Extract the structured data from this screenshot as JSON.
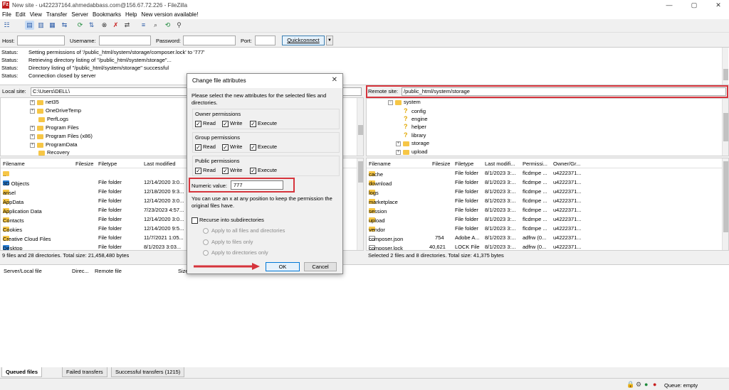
{
  "window": {
    "title": "New site - u422237164.ahmedabbass.com@156.67.72.226 - FileZilla",
    "app_icon": "Fz"
  },
  "menu": [
    "File",
    "Edit",
    "View",
    "Transfer",
    "Server",
    "Bookmarks",
    "Help",
    "New version available!"
  ],
  "quickconnect": {
    "host_label": "Host:",
    "username_label": "Username:",
    "password_label": "Password:",
    "port_label": "Port:",
    "button": "Quickconnect"
  },
  "log": [
    {
      "k": "Status:",
      "v": "Setting permissions of '/public_html/system/storage/composer.lock' to '777'"
    },
    {
      "k": "Status:",
      "v": "Retrieving directory listing of \"/public_html/system/storage\"..."
    },
    {
      "k": "Status:",
      "v": "Directory listing of \"/public_html/system/storage\" successful"
    },
    {
      "k": "Status:",
      "v": "Connection closed by server"
    }
  ],
  "local": {
    "site_label": "Local site:",
    "path": "C:\\Users\\DELL\\",
    "tree": [
      "net35",
      "OneDriveTemp",
      "PerfLogs",
      "Program Files",
      "Program Files (x86)",
      "ProgramData",
      "Recovery"
    ],
    "headers": {
      "name": "Filename",
      "size": "Filesize",
      "type": "Filetype",
      "modified": "Last modified"
    },
    "files": [
      {
        "name": "..",
        "size": "",
        "type": "",
        "modified": ""
      },
      {
        "name": "3D Objects",
        "size": "",
        "type": "File folder",
        "modified": "12/14/2020 3:0..."
      },
      {
        "name": "ansel",
        "size": "",
        "type": "File folder",
        "modified": "12/18/2020 9:3..."
      },
      {
        "name": "AppData",
        "size": "",
        "type": "File folder",
        "modified": "12/14/2020 3:0..."
      },
      {
        "name": "Application Data",
        "size": "",
        "type": "File folder",
        "modified": "7/23/2023 4:57..."
      },
      {
        "name": "Contacts",
        "size": "",
        "type": "File folder",
        "modified": "12/14/2020 3:0..."
      },
      {
        "name": "Cookies",
        "size": "",
        "type": "File folder",
        "modified": "12/14/2020 9:5..."
      },
      {
        "name": "Creative Cloud Files",
        "size": "",
        "type": "File folder",
        "modified": "11/7/2021 1:05..."
      },
      {
        "name": "Desktop",
        "size": "",
        "type": "File folder",
        "modified": "8/1/2023 3:03..."
      }
    ],
    "status": "9 files and 28 directories. Total size: 21,458,480 bytes"
  },
  "remote": {
    "site_label": "Remote site:",
    "path": "/public_html/system/storage",
    "tree": [
      {
        "name": "system",
        "kind": "folder"
      },
      {
        "name": "config",
        "kind": "unknown"
      },
      {
        "name": "engine",
        "kind": "unknown"
      },
      {
        "name": "helper",
        "kind": "unknown"
      },
      {
        "name": "library",
        "kind": "unknown"
      },
      {
        "name": "storage",
        "kind": "folder"
      },
      {
        "name": "upload",
        "kind": "folder"
      }
    ],
    "headers": {
      "name": "Filename",
      "size": "Filesize",
      "type": "Filetype",
      "modified": "Last modifi...",
      "perm": "Permissi...",
      "owner": "Owner/Gr..."
    },
    "files": [
      {
        "name": "cache",
        "size": "",
        "type": "File folder",
        "modified": "8/1/2023 3:...",
        "perm": "flcdmpe ...",
        "owner": "u4222371..."
      },
      {
        "name": "download",
        "size": "",
        "type": "File folder",
        "modified": "8/1/2023 3:...",
        "perm": "flcdmpe ...",
        "owner": "u4222371..."
      },
      {
        "name": "logs",
        "size": "",
        "type": "File folder",
        "modified": "8/1/2023 3:...",
        "perm": "flcdmpe ...",
        "owner": "u4222371..."
      },
      {
        "name": "marketplace",
        "size": "",
        "type": "File folder",
        "modified": "8/1/2023 3:...",
        "perm": "flcdmpe ...",
        "owner": "u4222371..."
      },
      {
        "name": "session",
        "size": "",
        "type": "File folder",
        "modified": "8/1/2023 3:...",
        "perm": "flcdmpe ...",
        "owner": "u4222371..."
      },
      {
        "name": "upload",
        "size": "",
        "type": "File folder",
        "modified": "8/1/2023 3:...",
        "perm": "flcdmpe ...",
        "owner": "u4222371..."
      },
      {
        "name": "vendor",
        "size": "",
        "type": "File folder",
        "modified": "8/1/2023 3:...",
        "perm": "flcdmpe ...",
        "owner": "u4222371..."
      },
      {
        "name": "composer.json",
        "size": "754",
        "type": "Adobe A...",
        "modified": "8/1/2023 3:...",
        "perm": "adfrw (0...",
        "owner": "u4222371..."
      },
      {
        "name": "composer.lock",
        "size": "40,621",
        "type": "LOCK File",
        "modified": "8/1/2023 3:...",
        "perm": "adfrw (0...",
        "owner": "u4222371..."
      }
    ],
    "status": "Selected 2 files and 8 directories. Total size: 41,375 bytes"
  },
  "queue": {
    "headers": {
      "server": "Server/Local file",
      "direction": "Direc...",
      "remote": "Remote file",
      "size": "Size"
    },
    "tabs": [
      "Queued files",
      "Failed transfers",
      "Successful transfers (1215)"
    ],
    "status": "Queue: empty"
  },
  "dialog": {
    "title": "Change file attributes",
    "intro": "Please select the new attributes for the selected files and directories.",
    "groups": [
      {
        "title": "Owner permissions",
        "read": "Read",
        "write": "Write",
        "execute": "Execute"
      },
      {
        "title": "Group permissions",
        "read": "Read",
        "write": "Write",
        "execute": "Execute"
      },
      {
        "title": "Public permissions",
        "read": "Read",
        "write": "Write",
        "execute": "Execute"
      }
    ],
    "numeric_label": "Numeric value:",
    "numeric_value": "777",
    "hint": "You can use an x at any position to keep the permission the original files have.",
    "recurse": "Recurse into subdirectories",
    "radios": [
      "Apply to all files and directories",
      "Apply to files only",
      "Apply to directories only"
    ],
    "ok": "OK",
    "cancel": "Cancel"
  },
  "colors": {
    "highlight": "#d6343c",
    "accent": "#0078d7",
    "folder": "#f6c646"
  }
}
